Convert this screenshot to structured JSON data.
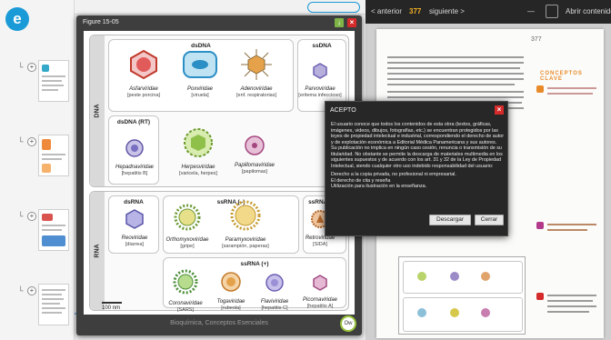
{
  "app": {
    "logo_letter": "e"
  },
  "reader": {
    "toolbar": {
      "prev_label": "< anterior",
      "page_number": "377",
      "next_label": "siguiente >",
      "right_label": "Abrir contenidos"
    },
    "side_tag": "CONCEPTOS CLAVE"
  },
  "figure": {
    "title": "Figure 15-05",
    "footer": "Bioquímica, Conceptos Esenciales",
    "zoom_label": "Ow",
    "scale_label": "100 nm",
    "dna_band_label": "DNA",
    "rna_band_label": "RNA",
    "groups": {
      "dsdna": "dsDNA",
      "ssdna": "ssDNA",
      "dsdna_rt": "dsDNA (RT)",
      "dsrna": "dsRNA",
      "ssrna_minus": "ssRNA (–)",
      "ssrna_rt": "ssRNA (RT)",
      "ssrna_plus": "ssRNA (+)"
    },
    "viruses": [
      {
        "name": "Asfarviridae",
        "disease": "[peste porcina]"
      },
      {
        "name": "Poxviridae",
        "disease": "[viruela]"
      },
      {
        "name": "Adenoviridae",
        "disease": "[enf. respiratorias]"
      },
      {
        "name": "Parvoviridae",
        "disease": "[eritema infeccioso]"
      },
      {
        "name": "Hepadnaviridae",
        "disease": "[hepatitis B]"
      },
      {
        "name": "Herpesviridae",
        "disease": "[varicela, herpes]"
      },
      {
        "name": "Papillomaviridae",
        "disease": "[papilomas]"
      },
      {
        "name": "Reoviridae",
        "disease": "[diarrea]"
      },
      {
        "name": "Orthomyxoviridae",
        "disease": "[gripe]"
      },
      {
        "name": "Paramyxoviridae",
        "disease": "[sarampión, paperas]"
      },
      {
        "name": "Retroviridae",
        "disease": "[SIDA]"
      },
      {
        "name": "Coronaviridae",
        "disease": "[SARS]"
      },
      {
        "name": "Togaviridae",
        "disease": "[rubeola]"
      },
      {
        "name": "Flaviviridae",
        "disease": "[hepatitis C]"
      },
      {
        "name": "Picornaviridae",
        "disease": "[hepatitis A]"
      }
    ]
  },
  "dialog": {
    "title": "ACEPTO",
    "paragraph1": "El usuario conoce que todos los contenidos de esta obra (textos, gráficas, imágenes, videos, dibujos, fotografías, etc.) se encuentran protegidos por las leyes de propiedad intelectual e industrial, correspondiendo el derecho de autor y de explotación económica a Editorial Médica Panamericana y sus autores. Su publicación no implica en ningún caso cesión, renuncia o transmisión de su titularidad. No obstante se permite la descarga de materiales multimedia en los siguientes supuestos y de acuerdo con los art. 31 y 32 de la Ley de Propiedad Intelectual, siendo cualquier otro uso indebido responsabilidad del usuario:",
    "paragraph2": "Derecho a la copia privada, no profesional ni empresarial.",
    "paragraph3": "El derecho de cita y reseña",
    "paragraph4": "Utilización para ilustración en la enseñanza.",
    "download_label": "Descargar",
    "close_label": "Cerrar"
  }
}
